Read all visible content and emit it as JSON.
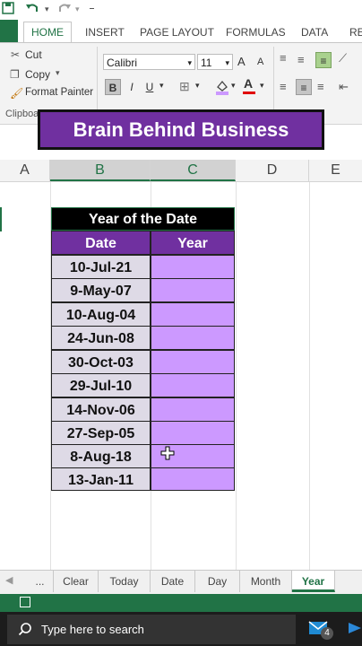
{
  "qat": {
    "save_icon": "save-icon",
    "undo_icon": "undo-icon",
    "redo_icon": "redo-icon"
  },
  "ribbon_tabs": [
    {
      "label": "HOME"
    },
    {
      "label": "INSERT"
    },
    {
      "label": "PAGE LAYOUT"
    },
    {
      "label": "FORMULAS"
    },
    {
      "label": "DATA"
    },
    {
      "label": "RE"
    }
  ],
  "clipboard": {
    "cut": "Cut",
    "copy": "Copy",
    "format_painter": "Format Painter",
    "group_label": "Clipboa"
  },
  "font": {
    "name": "Calibri",
    "size": "11",
    "bold": "B",
    "italic": "I",
    "underline": "U",
    "grow": "A",
    "shrink": "A",
    "font_color_letter": "A"
  },
  "colors": {
    "accent": "#217346",
    "purple": "#7030a0",
    "year_fill": "#cc99ff",
    "date_fill": "#dedae6",
    "banner_bg": "#7030a0"
  },
  "banner": {
    "text": "Brain Behind Business"
  },
  "columns": [
    "A",
    "B",
    "C",
    "D",
    "E"
  ],
  "table": {
    "title": "Year of the Date",
    "headers": [
      "Date",
      "Year"
    ],
    "dates": [
      "10-Jul-21",
      "9-May-07",
      "10-Aug-04",
      "24-Jun-08",
      "30-Oct-03",
      "29-Jul-10",
      "14-Nov-06",
      "27-Sep-05",
      "8-Aug-18",
      "13-Jan-11"
    ]
  },
  "sheet_tabs": {
    "more": "...",
    "tabs": [
      "Clear",
      "Today",
      "Date",
      "Day",
      "Month",
      "Year"
    ],
    "active": "Year"
  },
  "taskbar": {
    "search_placeholder": "Type here to search",
    "mail_badge": "4"
  }
}
